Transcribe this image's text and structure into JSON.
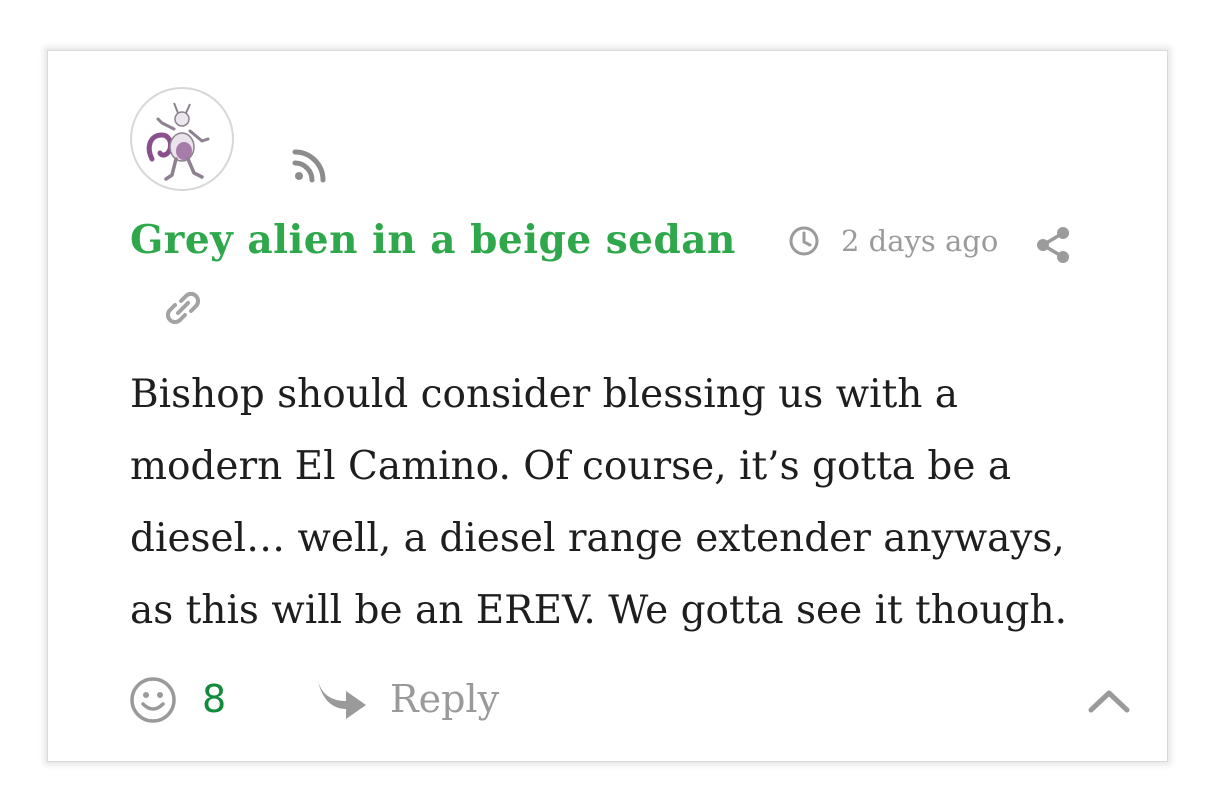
{
  "comment": {
    "author": "Grey alien in a beige sedan",
    "timestamp": "2 days ago",
    "body_lines": [
      "Bishop should consider blessing us with a",
      "modern El Camino. Of course, it’s gotta be a",
      "diesel… well, a diesel range extender anyways,",
      "as this will be an EREV. We gotta see it though."
    ],
    "likes": "8",
    "reply_label": "Reply",
    "avatar_alt": "avatar",
    "icons": {
      "author_badge": "rss-icon",
      "time": "clock-icon",
      "share": "share-icon",
      "permalink": "link-icon",
      "reaction": "smile-icon",
      "reply": "reply-arrow-icon",
      "collapse": "chevron-up-icon"
    }
  },
  "colors": {
    "author": "#2ea84a",
    "like_count": "#128a3c",
    "muted": "#9b9b9b",
    "text": "#1e1e1e"
  }
}
